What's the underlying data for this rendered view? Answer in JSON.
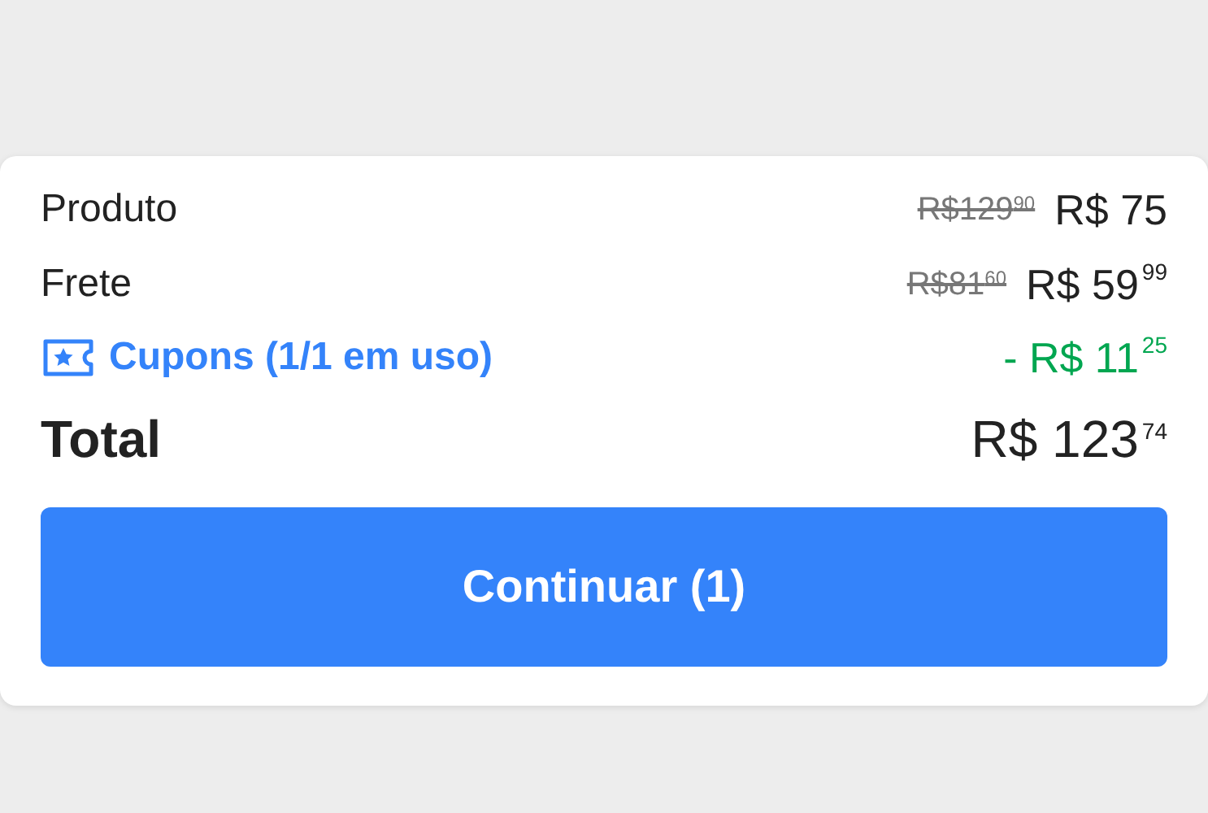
{
  "summary": {
    "rows": [
      {
        "kind": "line",
        "label": "Produto",
        "old_price": "R$129$^{90}$",
        "price": "R$ 75"
      },
      {
        "kind": "line",
        "label": "Frete",
        "old_price": "R$81$^{60}$",
        "price": "R$ 59$^{99}$"
      },
      {
        "kind": "coupon",
        "label": "Cupons (1/1 em uso)",
        "price": "- R$ 11$^{25}$"
      },
      {
        "kind": "total",
        "label": "Total",
        "price": "R$ 123$^{74}$"
      }
    ],
    "button": "Continuar (1)"
  }
}
